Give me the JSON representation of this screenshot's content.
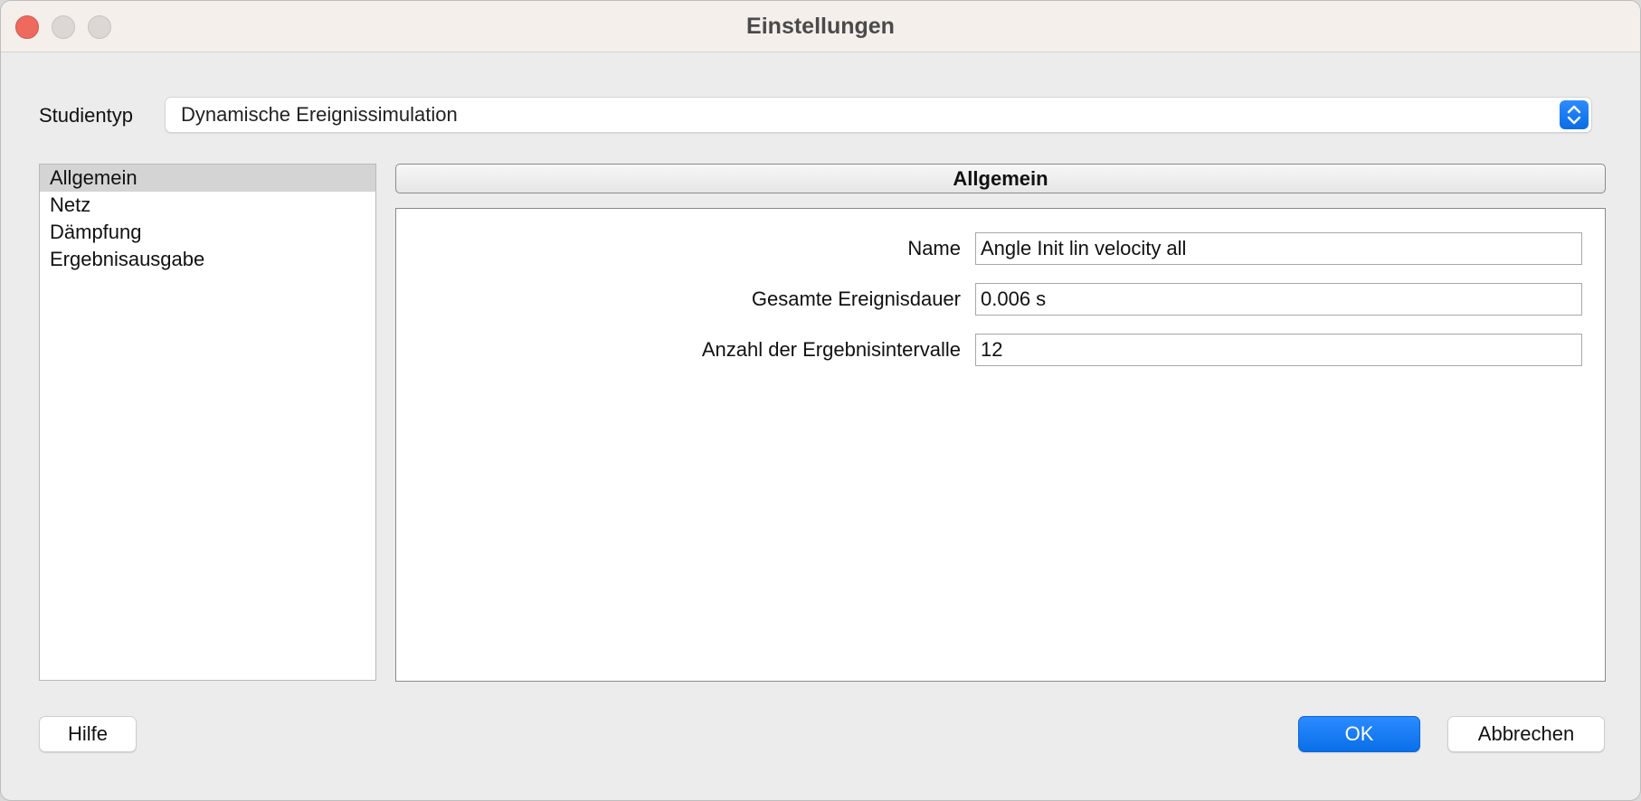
{
  "window": {
    "title": "Einstellungen"
  },
  "study": {
    "label": "Studientyp",
    "selected": "Dynamische Ereignissimulation"
  },
  "categories": [
    {
      "label": "Allgemein",
      "selected": true
    },
    {
      "label": "Netz",
      "selected": false
    },
    {
      "label": "Dämpfung",
      "selected": false
    },
    {
      "label": "Ergebnisausgabe",
      "selected": false
    }
  ],
  "section": {
    "title": "Allgemein"
  },
  "form": {
    "name_label": "Name",
    "name_value": "Angle Init lin velocity all",
    "duration_label": "Gesamte Ereignisdauer",
    "duration_value": "0.006 s",
    "intervals_label": "Anzahl der Ergebnisintervalle",
    "intervals_value": "12"
  },
  "buttons": {
    "help": "Hilfe",
    "ok": "OK",
    "cancel": "Abbrechen"
  },
  "colors": {
    "accent": "#0a6fe8",
    "close": "#ee6a5e"
  },
  "icons": {
    "close": "close-icon",
    "minimize": "minimize-icon",
    "maximize": "maximize-icon",
    "select_stepper": "chevron-up-down-icon"
  }
}
